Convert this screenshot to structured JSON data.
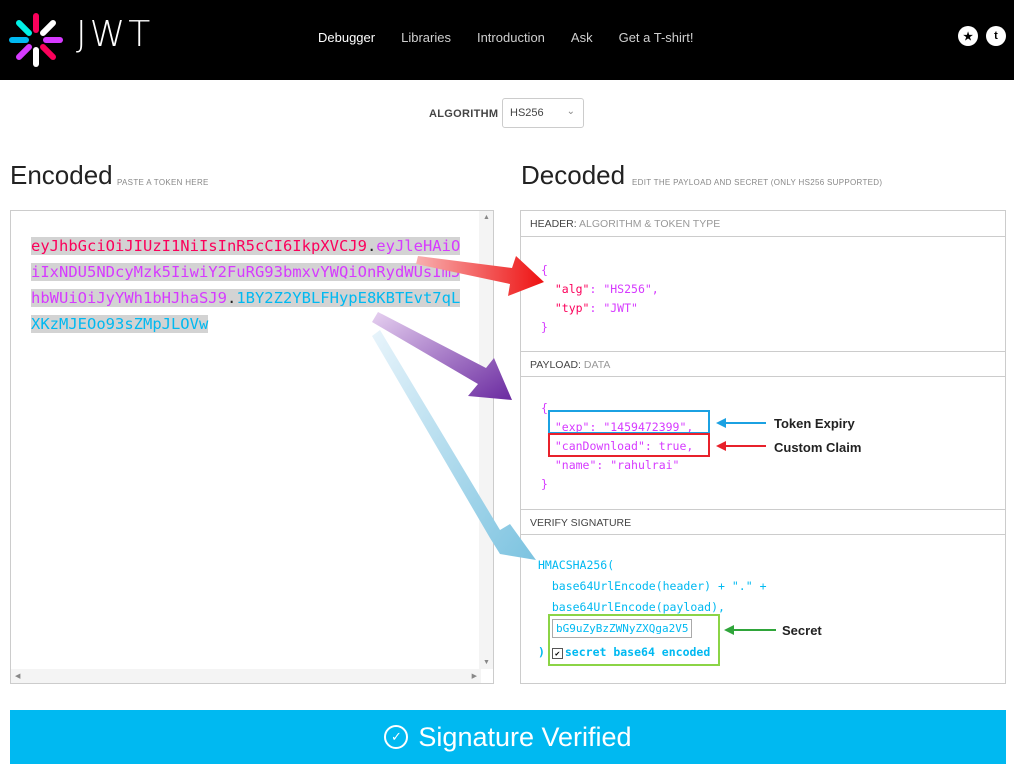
{
  "brand": {
    "name": "JWT"
  },
  "nav": [
    {
      "label": "Debugger",
      "active": true
    },
    {
      "label": "Libraries"
    },
    {
      "label": "Introduction"
    },
    {
      "label": "Ask"
    },
    {
      "label": "Get a T-shirt!"
    }
  ],
  "algorithm": {
    "label": "ALGORITHM",
    "value": "HS256"
  },
  "encoded": {
    "title": "Encoded",
    "subtitle": "PASTE A TOKEN HERE",
    "token_header": "eyJhbGciOiJIUzI1NiIsInR5cCI6IkpXVCJ9",
    "token_payload": "eyJleHAiOiIxNDU5NDcyMzk5IiwiY2FuRG93bmxvYWQiOnRydWUsIm5hbWUiOiJyYWh1bHJhaSJ9",
    "token_signature": "1BY2Z2YBLFHypE8KBTEvt7qLXKzMJEOo93sZMpJLOVw",
    "dot": "."
  },
  "decoded": {
    "title": "Decoded",
    "subtitle": "EDIT THE PAYLOAD AND SECRET (ONLY HS256 SUPPORTED)",
    "header_panel": {
      "label": "HEADER:",
      "sub": "ALGORITHM & TOKEN TYPE"
    },
    "payload_panel": {
      "label": "PAYLOAD:",
      "sub": "DATA"
    },
    "signature_panel": {
      "label": "VERIFY SIGNATURE"
    },
    "header_json": {
      "open": "{",
      "alg_key": "\"alg\"",
      "alg_val": ": \"HS256\",",
      "typ_key": "\"typ\"",
      "typ_val": ": \"JWT\"",
      "close": "}"
    },
    "payload_json": {
      "open": "{",
      "exp_line": "\"exp\": \"1459472399\",",
      "can_line": "\"canDownload\": true,",
      "name_line": "\"name\": \"rahulrai\"",
      "close": "}"
    },
    "signature": {
      "fn": "HMACSHA256(",
      "line1": "base64UrlEncode(header) + \".\" +",
      "line2": "base64UrlEncode(payload),",
      "secret": "bG9uZyBzZWNyZXQga2V5",
      "close": ")",
      "checkbox_label": "secret base64 encoded",
      "checked": true
    }
  },
  "annotations": {
    "token_expiry": "Token Expiry",
    "custom_claim": "Custom Claim",
    "secret": "Secret"
  },
  "colors": {
    "header": "#fb015b",
    "payload": "#d63aff",
    "signature": "#00b9f1"
  },
  "verified": {
    "label": "Signature Verified",
    "icon": "check-circle-icon"
  }
}
